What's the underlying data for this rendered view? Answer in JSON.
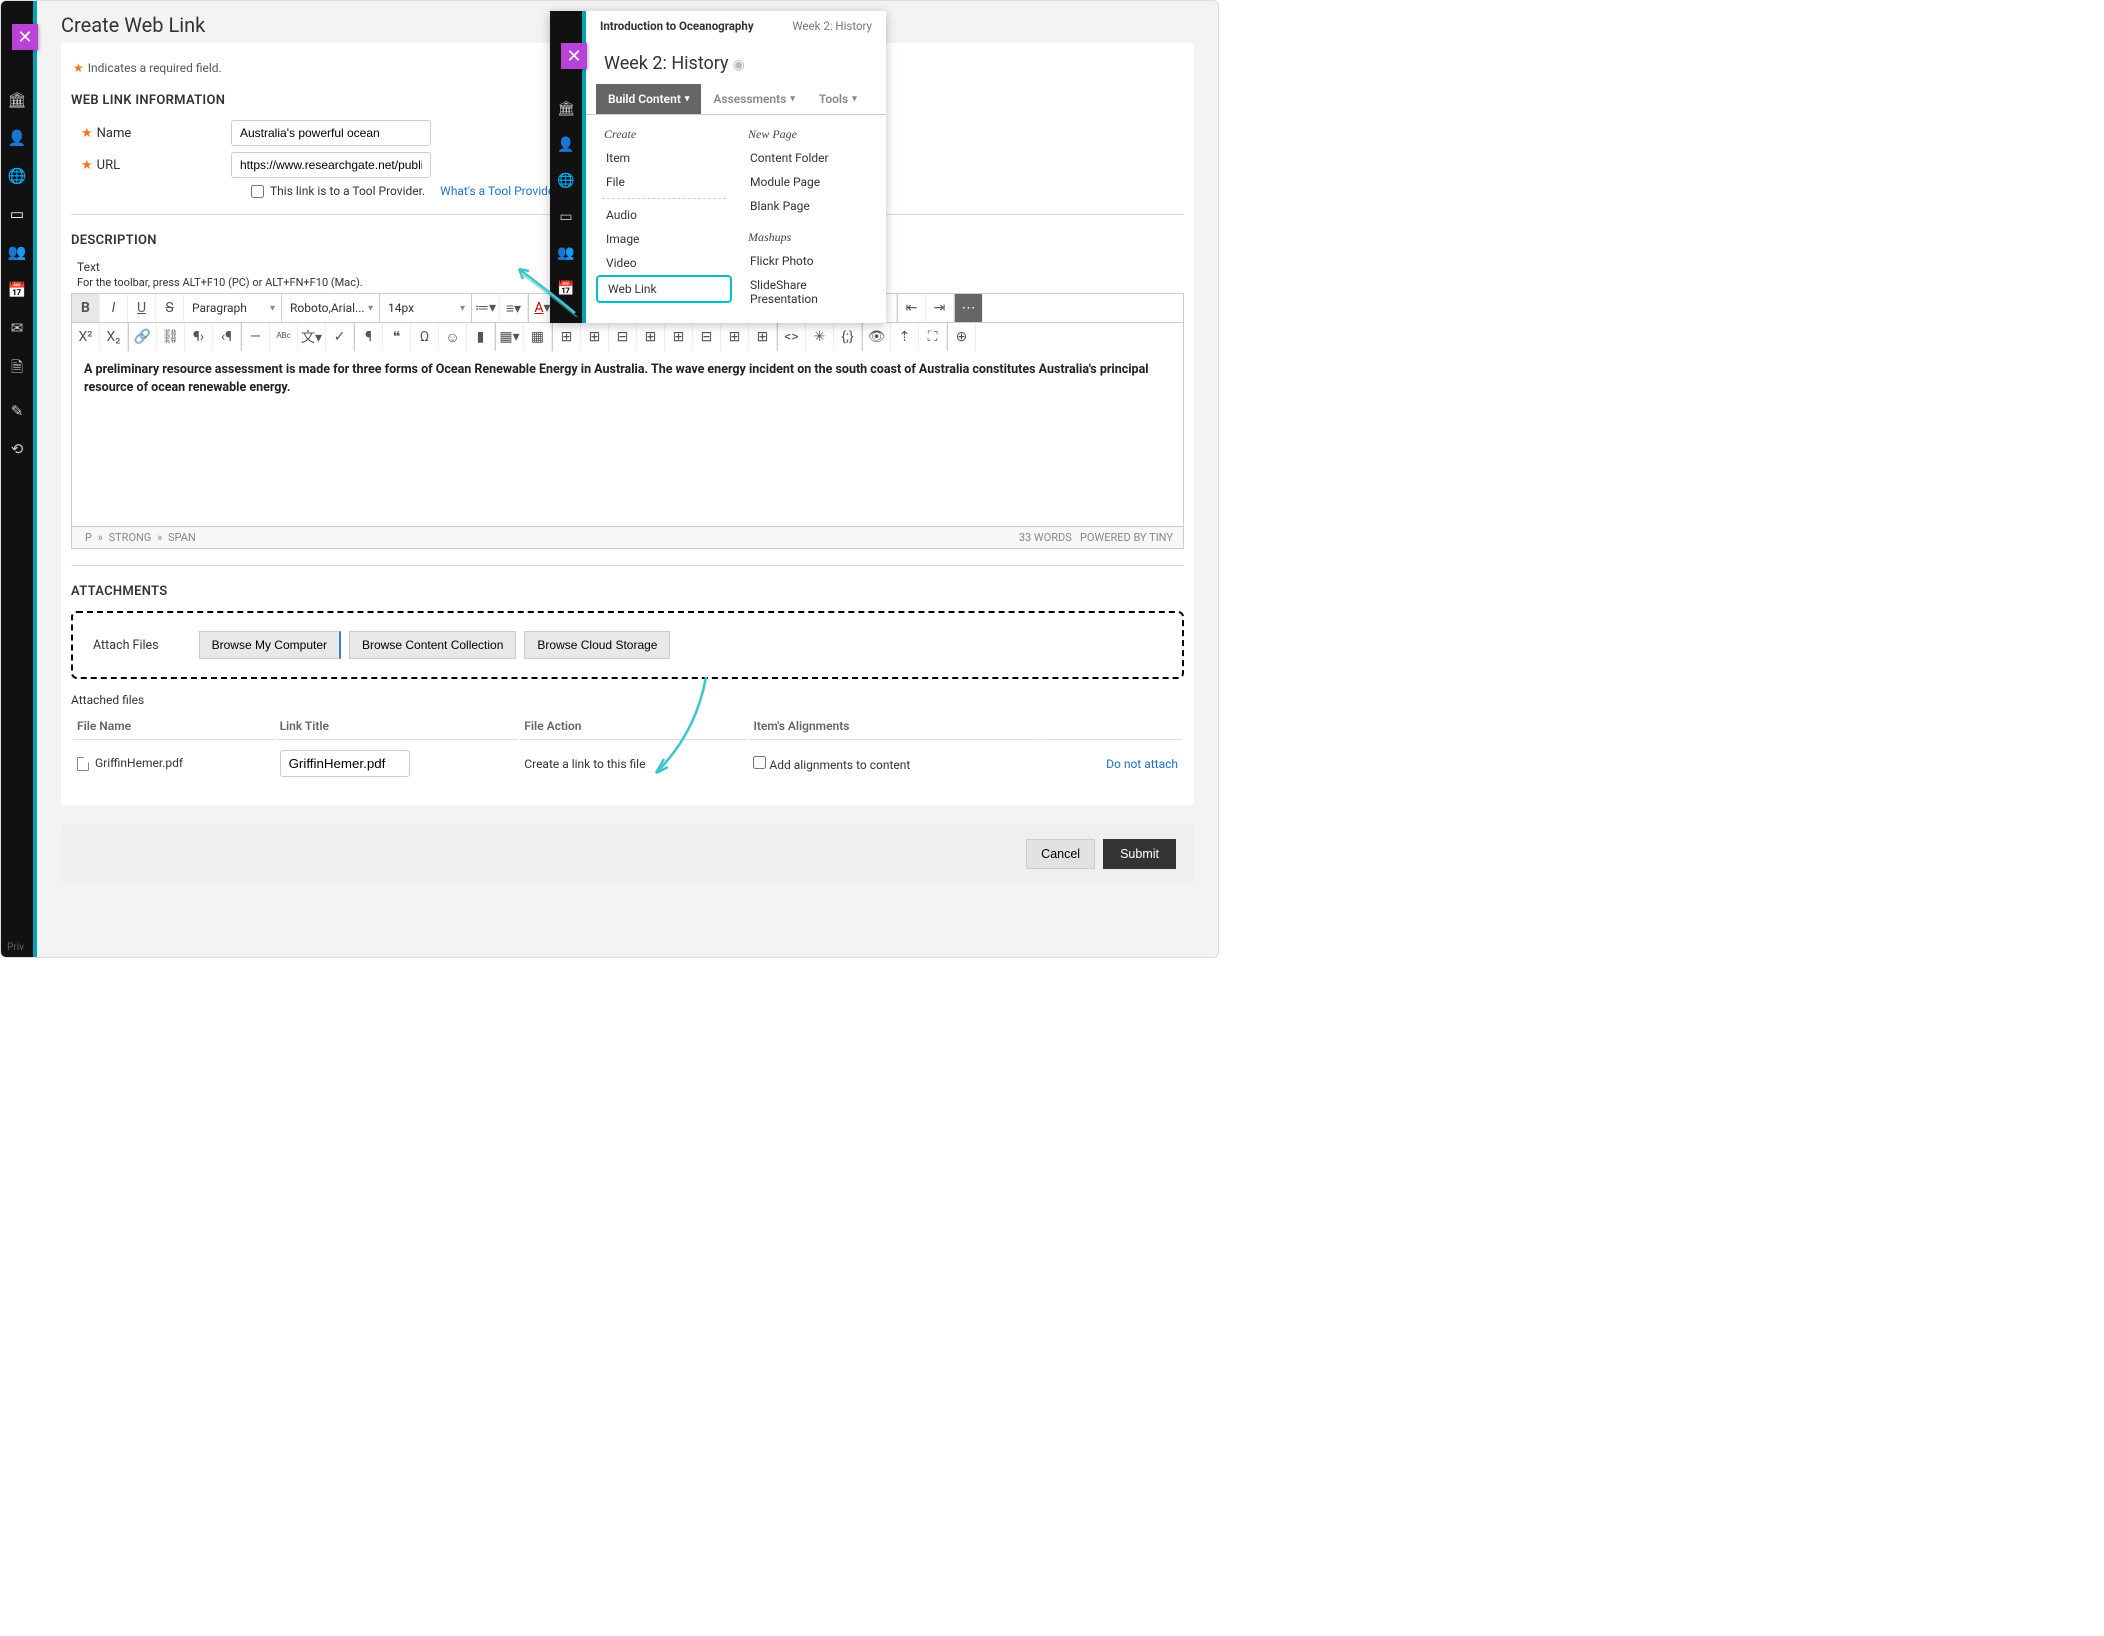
{
  "page": {
    "title": "Create Web Link",
    "req_note": "Indicates a required field."
  },
  "section_info": "WEB LINK INFORMATION",
  "form": {
    "name_label": "Name",
    "name_value": "Australia's powerful ocean",
    "url_label": "URL",
    "url_value": "https://www.researchgate.net/publication",
    "toolprov_label": "This link is to a Tool Provider.",
    "toolprov_help": "What's a Tool Provider?"
  },
  "section_desc": "DESCRIPTION",
  "rte": {
    "text_label": "Text",
    "hint": "For the toolbar, press ALT+F10 (PC) or ALT+FN+F10 (Mac).",
    "block": "Paragraph",
    "font": "Roboto,Arial...",
    "size": "14px",
    "body": "A preliminary resource assessment is made for three forms of Ocean Renewable Energy in Australia. The wave energy incident on the south coast of Australia constitutes Australia's principal resource of ocean renewable energy.",
    "path_p": "P",
    "path_strong": "STRONG",
    "path_span": "SPAN",
    "words": "33 WORDS",
    "powered": "POWERED BY TINY"
  },
  "section_attach": "ATTACHMENTS",
  "attach": {
    "label": "Attach Files",
    "browse_computer": "Browse My Computer",
    "browse_collection": "Browse Content Collection",
    "browse_cloud": "Browse Cloud Storage",
    "attached_title": "Attached files",
    "col_filename": "File Name",
    "col_linktitle": "Link Title",
    "col_action": "File Action",
    "col_align": "Item's Alignments",
    "file_name": "GriffinHemer.pdf",
    "link_title_value": "GriffinHemer.pdf",
    "file_action": "Create a link to this file",
    "align_label": "Add alignments to content",
    "do_not_attach": "Do not attach"
  },
  "footer": {
    "cancel": "Cancel",
    "submit": "Submit"
  },
  "popup": {
    "bc_left": "Introduction to Oceanography",
    "bc_right": "Week 2: History",
    "heading": "Week 2: History",
    "tabs": {
      "build": "Build Content",
      "assess": "Assessments",
      "tools": "Tools"
    },
    "create_h": "Create",
    "item": "Item",
    "file": "File",
    "audio": "Audio",
    "image": "Image",
    "video": "Video",
    "weblink": "Web Link",
    "newpage_h": "New Page",
    "content_folder": "Content Folder",
    "module_page": "Module Page",
    "blank_page": "Blank Page",
    "mashups_h": "Mashups",
    "flickr": "Flickr Photo",
    "slideshare": "SlideShare Presentation"
  },
  "priv": "Priv"
}
